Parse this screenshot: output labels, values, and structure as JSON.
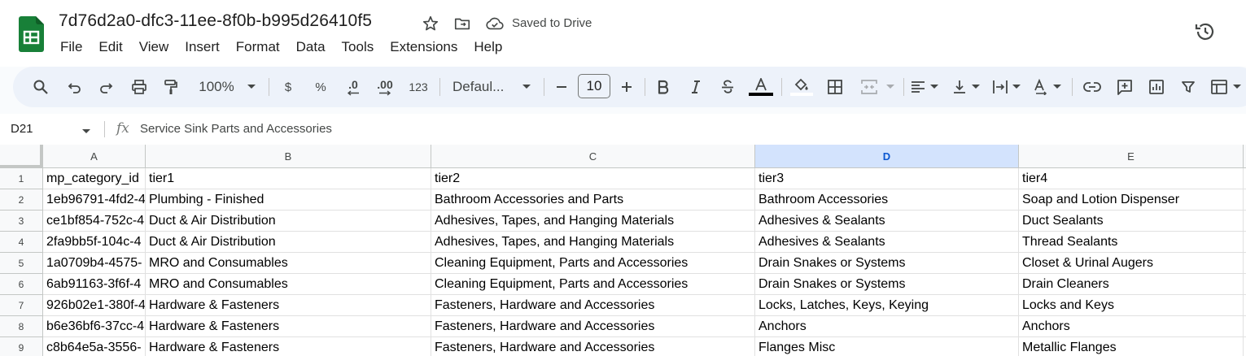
{
  "document": {
    "title": "7d76d2a0-dfc3-11ee-8f0b-b995d26410f5",
    "save_status": "Saved to Drive"
  },
  "menu": [
    "File",
    "Edit",
    "View",
    "Insert",
    "Format",
    "Data",
    "Tools",
    "Extensions",
    "Help"
  ],
  "toolbar": {
    "zoom": "100%",
    "currency_symbol": "$",
    "percent_symbol": "%",
    "decrease_decimal": ".0",
    "increase_decimal": ".00",
    "number_format": "123",
    "font_name": "Defaul...",
    "font_size": "10"
  },
  "formula_bar": {
    "cell_reference": "D21",
    "fx_label": "fx",
    "content": "Service Sink Parts and Accessories"
  },
  "sheet": {
    "selected_column": "D",
    "columns": [
      "A",
      "B",
      "C",
      "D",
      "E"
    ],
    "row_numbers": [
      "1",
      "2",
      "3",
      "4",
      "5",
      "6",
      "7",
      "8",
      "9"
    ],
    "rows": [
      [
        "mp_category_id",
        "tier1",
        "tier2",
        "tier3",
        "tier4"
      ],
      [
        "1eb96791-4fd2-4",
        "Plumbing - Finished",
        "Bathroom Accessories and Parts",
        "Bathroom Accessories",
        "Soap and Lotion Dispenser"
      ],
      [
        "ce1bf854-752c-4",
        "Duct & Air Distribution",
        "Adhesives, Tapes, and Hanging Materials",
        "Adhesives & Sealants",
        "Duct Sealants"
      ],
      [
        "2fa9bb5f-104c-4",
        "Duct & Air Distribution",
        "Adhesives, Tapes, and Hanging Materials",
        "Adhesives & Sealants",
        "Thread Sealants"
      ],
      [
        "1a0709b4-4575-",
        "MRO and Consumables",
        "Cleaning Equipment, Parts and Accessories",
        "Drain Snakes or Systems",
        "Closet & Urinal Augers"
      ],
      [
        "6ab91163-3f6f-4",
        "MRO and Consumables",
        "Cleaning Equipment, Parts and Accessories",
        "Drain Snakes or Systems",
        "Drain Cleaners"
      ],
      [
        "926b02e1-380f-4",
        "Hardware & Fasteners",
        "Fasteners, Hardware and Accessories",
        "Locks, Latches,  Keys, Keying",
        "Locks and Keys"
      ],
      [
        "b6e36bf6-37cc-4",
        "Hardware & Fasteners",
        "Fasteners, Hardware and Accessories",
        "Anchors",
        "Anchors"
      ],
      [
        "c8b64e5a-3556-",
        "Hardware & Fasteners",
        "Fasteners, Hardware and Accessories",
        "Flanges Misc",
        "Metallic Flanges"
      ]
    ]
  },
  "colors": {
    "sheets_green": "#188038",
    "toolbar_bg": "#edf2fa",
    "selected_header_bg": "#d3e3fd",
    "selected_header_text": "#0b57d0"
  },
  "icons": [
    "sheets-logo-icon",
    "star-icon",
    "move-folder-icon",
    "cloud-saved-icon",
    "version-history-icon",
    "search-icon",
    "undo-icon",
    "redo-icon",
    "print-icon",
    "paint-format-icon",
    "bold-icon",
    "italic-icon",
    "strikethrough-icon",
    "text-color-icon",
    "fill-color-icon",
    "borders-icon",
    "merge-cells-icon",
    "align-icon",
    "vertical-align-icon",
    "text-wrap-icon",
    "text-rotation-icon",
    "link-icon",
    "comment-icon",
    "chart-icon",
    "filter-icon",
    "filter-views-icon"
  ]
}
